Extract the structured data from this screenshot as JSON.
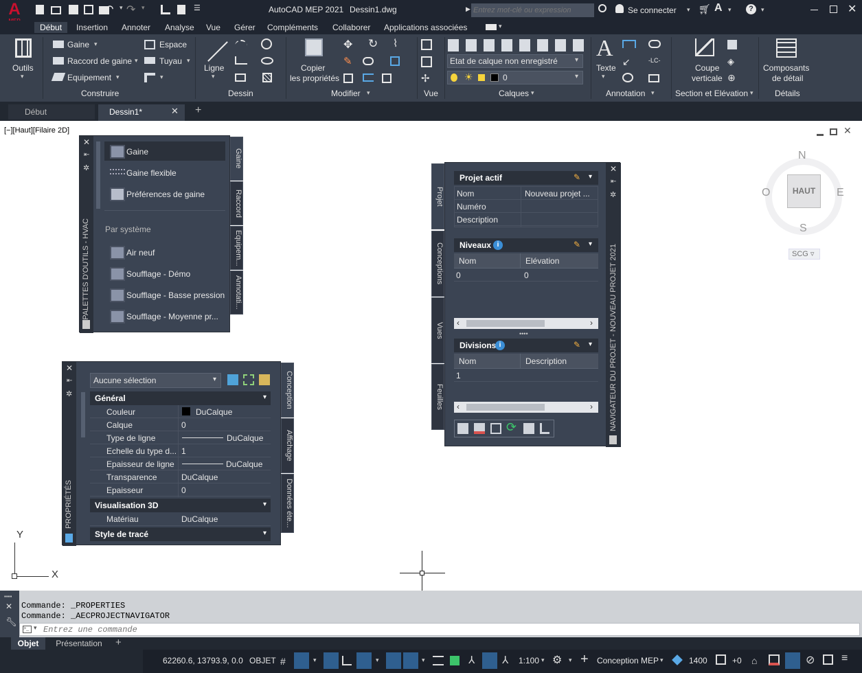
{
  "app": {
    "title": "AutoCAD MEP 2021",
    "document": "Dessin1.dwg",
    "logo_letter": "A",
    "logo_sub": "MEP",
    "search_placeholder": "Entrez mot-clé ou expression",
    "signin": "Se connecter"
  },
  "ribbon_tabs": [
    "Début",
    "Insertion",
    "Annoter",
    "Analyse",
    "Vue",
    "Gérer",
    "Compléments",
    "Collaborer",
    "Applications associées"
  ],
  "ribbon": {
    "outils": "Outils",
    "construire": {
      "title": "Construire",
      "gaine": "Gaine",
      "raccord": "Raccord de gaine",
      "equipement": "Equipement",
      "espace": "Espace",
      "tuyau": "Tuyau"
    },
    "dessin": {
      "title": "Dessin",
      "ligne": "Ligne"
    },
    "modifier": {
      "title": "Modifier",
      "copier1": "Copier",
      "copier2": "les propriétés"
    },
    "vue": {
      "title": "Vue"
    },
    "calques": {
      "title": "Calques",
      "etat": "Etat de calque non enregistré",
      "layer": "0"
    },
    "annotation": {
      "title": "Annotation",
      "texte": "Texte"
    },
    "section": {
      "title": "Section et Elévation",
      "coupe1": "Coupe",
      "coupe2": "verticale"
    },
    "details": {
      "title": "Détails",
      "comp1": "Composants",
      "comp2": "de détail"
    }
  },
  "doc_tabs": [
    "Début",
    "Dessin1*"
  ],
  "viewport_label": "[−][Haut][Filaire 2D]",
  "viewcube": {
    "n": "N",
    "s": "S",
    "e": "E",
    "o": "O",
    "center": "HAUT",
    "scg": "SCG"
  },
  "tool_palette": {
    "title": "PALETTES D'OUTILS - HVAC",
    "items": [
      "Gaine",
      "Gaine flexible",
      "Préférences de gaine"
    ],
    "section": "Par système",
    "systems": [
      "Air neuf",
      "Soufflage - Démo",
      "Soufflage - Basse pression",
      "Soufflage -  Moyenne pr..."
    ],
    "tabs": [
      "Gaine",
      "Raccord",
      "Equipem...",
      "Annotati..."
    ]
  },
  "properties": {
    "title": "PROPRIÉTÉS",
    "selection": "Aucune sélection",
    "general": "Général",
    "rows": [
      {
        "k": "Couleur",
        "v": "DuCalque"
      },
      {
        "k": "Calque",
        "v": "0"
      },
      {
        "k": "Type de ligne",
        "v": "DuCalque"
      },
      {
        "k": "Echelle du type d...",
        "v": "1"
      },
      {
        "k": "Epaisseur de ligne",
        "v": "DuCalque"
      },
      {
        "k": "Transparence",
        "v": "DuCalque"
      },
      {
        "k": "Epaisseur",
        "v": "0"
      }
    ],
    "visu": "Visualisation 3D",
    "materiau_k": "Matériau",
    "materiau_v": "DuCalque",
    "style": "Style de tracé",
    "tabs": [
      "Conception",
      "Affichage",
      "Données éte..."
    ]
  },
  "navigator": {
    "title": "NAVIGATEUR DU PROJET - NOUVEAU PROJET 2021",
    "tabs": [
      "Projet",
      "Conceptions",
      "Vues",
      "Feuilles"
    ],
    "projet_actif": "Projet actif",
    "projet_rows": [
      {
        "k": "Nom",
        "v": "Nouveau projet ..."
      },
      {
        "k": "Numéro",
        "v": ""
      },
      {
        "k": "Description",
        "v": ""
      }
    ],
    "niveaux": "Niveaux",
    "niveaux_cols": [
      "Nom",
      "Elévation"
    ],
    "niveaux_row": [
      "0",
      "0"
    ],
    "divisions": "Divisions",
    "divisions_cols": [
      "Nom",
      "Description"
    ],
    "divisions_row": [
      "1",
      ""
    ]
  },
  "command": {
    "lines": [
      "Commande:  _PROPERTIES",
      "Commande:  _AECPROJECTNAVIGATOR"
    ],
    "placeholder": "Entrez une commande"
  },
  "layout_tabs": [
    "Objet",
    "Présentation"
  ],
  "status": {
    "coords": "62260.6, 13793.9, 0.0",
    "objet": "OBJET",
    "scale": "1:100",
    "workspace": "Conception MEP",
    "elev": "1400",
    "plus": "+0"
  },
  "colors": {
    "ribbon": "#39414e",
    "title": "#1f2530",
    "accent": "#2f6fb0",
    "logo": "#c8102e"
  }
}
